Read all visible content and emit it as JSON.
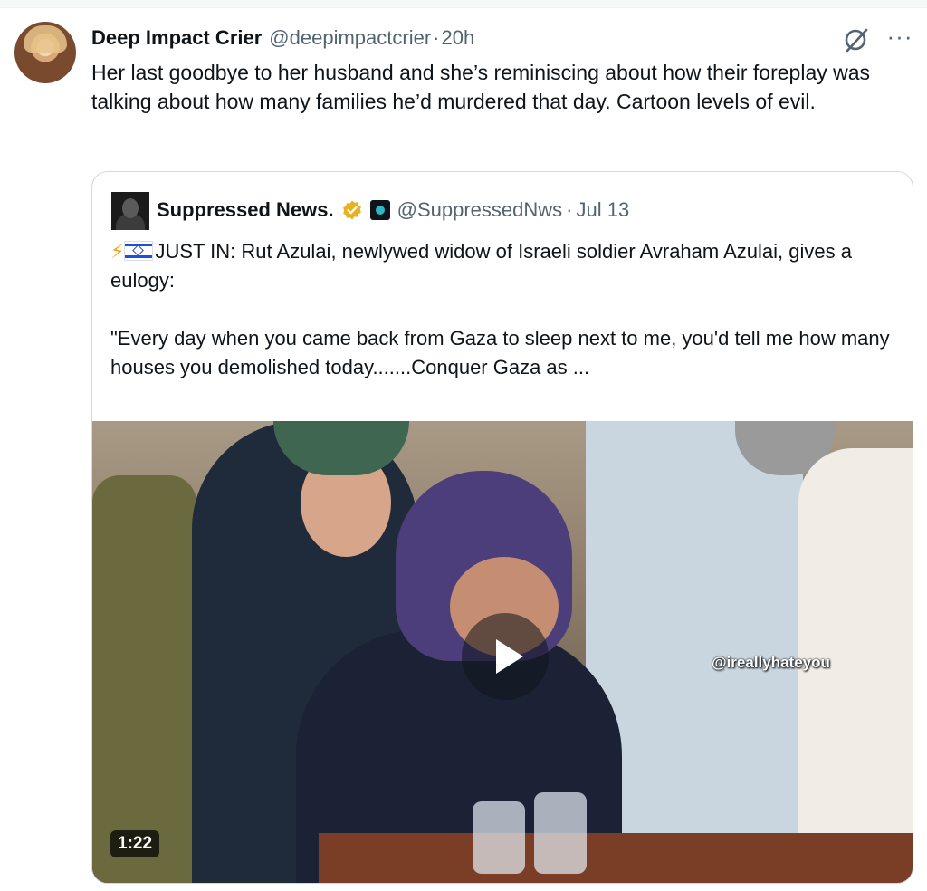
{
  "tweet": {
    "author_name": "Deep Impact Crier",
    "handle": "@deepimpactcrier",
    "separator": "·",
    "time": "20h",
    "more_label": "···",
    "text": "Her last goodbye to her husband and she’s reminiscing about how their foreplay was talking about how many families he’d murdered that day. Cartoon levels of evil."
  },
  "quote": {
    "author_name": "Suppressed News.",
    "handle": "@SuppressedNws",
    "separator": "·",
    "time": "Jul 13",
    "bolt": "⚡",
    "text_line1": "JUST IN: Rut Azulai, newlywed widow of  Israeli soldier Avraham Azulai, gives a eulogy:",
    "text_body": "\"Every day when you came back from Gaza to sleep next to me, you'd tell me how many houses you demolished today.......Conquer Gaza as ...",
    "video": {
      "duration": "1:22",
      "watermark": "@ireallyhateyou"
    }
  },
  "colors": {
    "text": "#0f1419",
    "muted": "#536471",
    "border": "#cfd9de",
    "verified_gold": "#e8b21e"
  },
  "icons": [
    "grok-icon",
    "more-icon",
    "verified-gold-badge",
    "affiliate-badge",
    "israel-flag-icon",
    "play-icon"
  ]
}
